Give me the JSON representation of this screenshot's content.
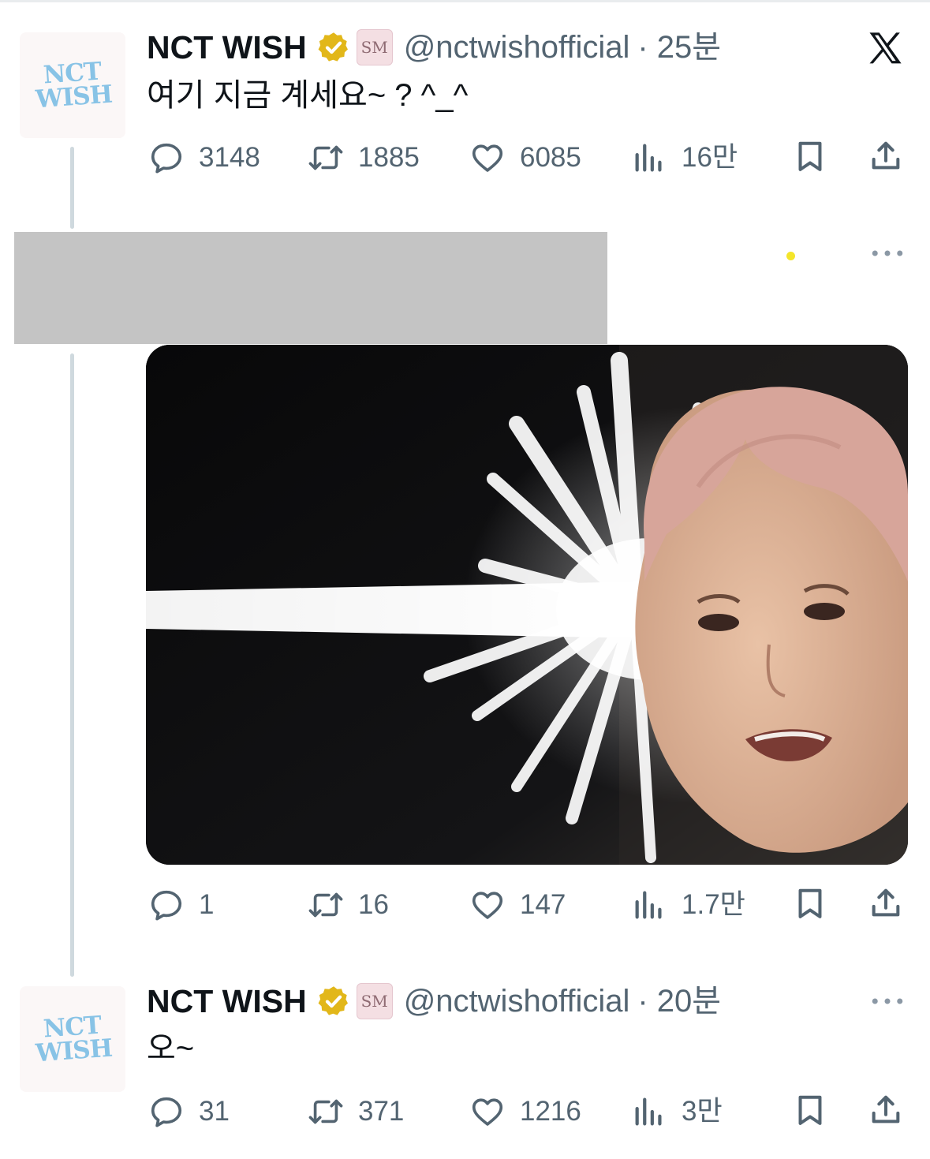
{
  "account": {
    "name": "NCT WISH",
    "handle": "@nctwishofficial",
    "avatar_logo_line1": "NCT",
    "avatar_logo_line2": "WISH",
    "affiliate_badge": "SM"
  },
  "colors": {
    "text_primary": "#0f1419",
    "text_secondary": "#536471",
    "thread_line": "#cfd9de",
    "verified_gold": "#e2b719",
    "redaction_gray": "#c4c4c4"
  },
  "tweets": [
    {
      "time": "· 25분",
      "text": "여기 지금 계세요~ ? ^_^",
      "replies": "3148",
      "retweets": "1885",
      "likes": "6085",
      "views": "16만"
    },
    {
      "replies": "1",
      "retweets": "16",
      "likes": "147",
      "views": "1.7만"
    },
    {
      "time": "· 20분",
      "text": "오~",
      "replies": "31",
      "retweets": "371",
      "likes": "1216",
      "views": "3만"
    }
  ],
  "icons": {
    "logo": "x-logo-icon",
    "more": "more-horizontal-icon",
    "reply": "speech-bubble-icon",
    "retweet": "retweet-arrows-icon",
    "like": "heart-icon",
    "views": "bar-chart-icon",
    "bookmark": "bookmark-icon",
    "share": "share-upload-icon"
  }
}
